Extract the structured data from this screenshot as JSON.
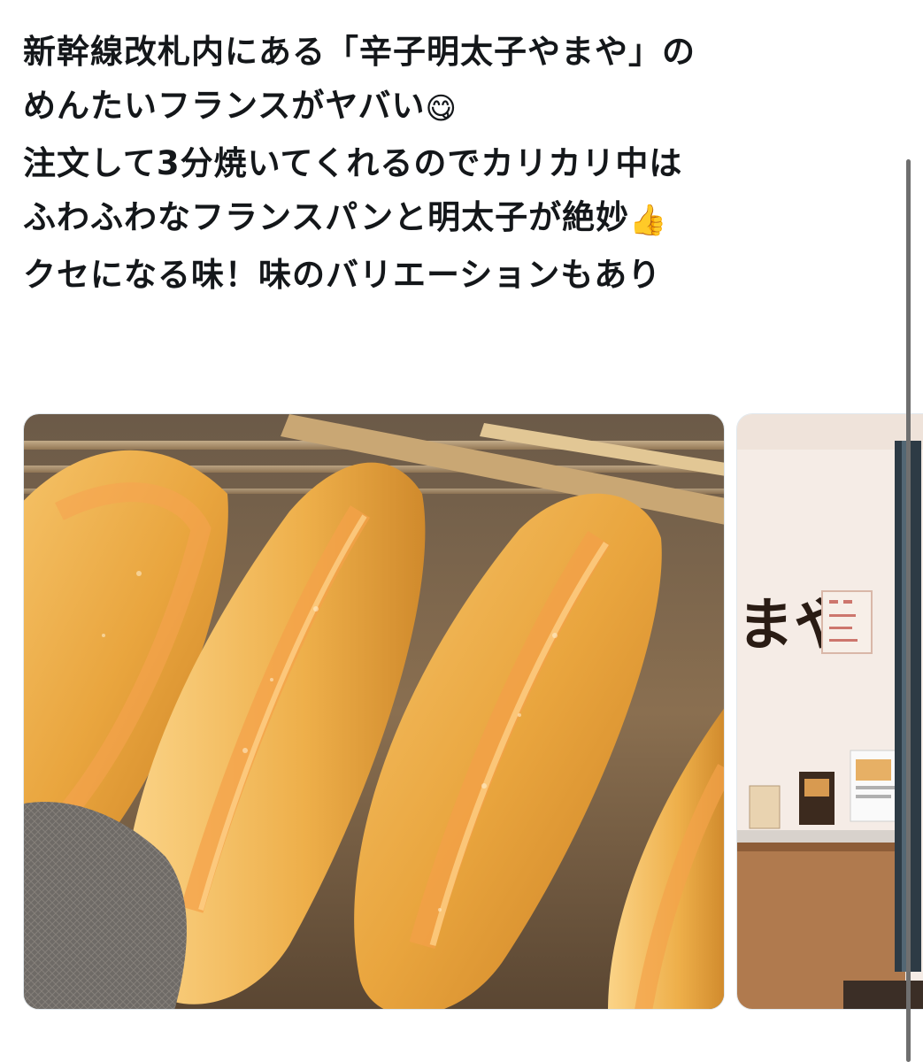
{
  "tweet": {
    "lines": [
      {
        "text": "新幹線改札内にある「辛子明太子やまや」の",
        "emoji": ""
      },
      {
        "text": "めんたいフランスがヤバい",
        "emoji": "😋"
      },
      {
        "text": "注文して3分焼いてくれるのでカリカリ中は",
        "emoji": ""
      },
      {
        "text": "ふわふわなフランスパンと明太子が絶妙",
        "emoji": "👍"
      },
      {
        "text": "クセになる味！味のバリエーションもあり",
        "emoji": ""
      }
    ]
  },
  "media": {
    "photos": [
      {
        "name": "mentai-france-bread-photo"
      },
      {
        "name": "yamaya-shop-photo",
        "sign_text": "まや"
      }
    ]
  },
  "colors": {
    "text": "#14171a",
    "background": "#ffffff",
    "bread_crust": "#e9a53e",
    "mentaiko": "#f2a24a",
    "shop_wall": "#f5ece6"
  }
}
